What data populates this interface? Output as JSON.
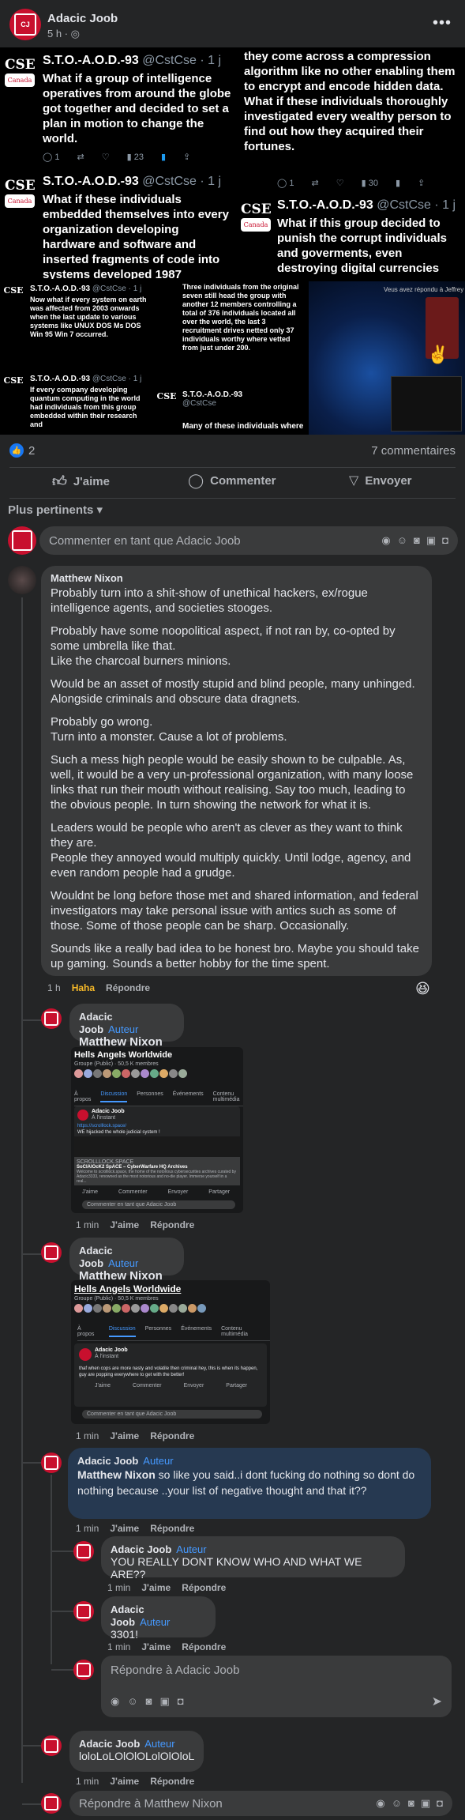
{
  "header": {
    "page_name": "Adacic Joob",
    "time": "5 h",
    "more_icon": "more-horizontal-icon"
  },
  "tweets": [
    {
      "handle": "S.T.O.-A.O.D.-93",
      "at": "@CstCse · 1 j",
      "body": "What if a group of intelligence operatives from around the globe got together and decided to set a plan in motion to change the world.",
      "stats": [
        "1",
        "",
        "",
        "23",
        "",
        ""
      ]
    },
    {
      "body": "they come across a compression algorithm like no other enabling them to encrypt and encode hidden data. What if these individuals thoroughly investigated every wealthy person to find out how they acquired their fortunes.",
      "stats": [
        "1",
        "",
        "",
        "30",
        "",
        ""
      ]
    },
    {
      "handle": "S.T.O.-A.O.D.-93",
      "at": "@CstCse · 1 j",
      "body": "What if these individuals embedded themselves into every organization developing hardware and software and inserted fragments of code into systems developed 1987"
    },
    {
      "handle": "S.T.O.-A.O.D.-93",
      "at": "@CstCse · 1 j",
      "body": "What if this group decided to punish the corrupt individuals and goverments, even destroying digital currencies"
    },
    {
      "handle": "S.T.O.-A.O.D.-93",
      "at": "@CstCse · 1 j",
      "body": "Now what if every system on earth was affected from 2003 onwards when the last update to various systems like UNUX DOS Ms DOS Win 95 Win 7 occurred."
    },
    {
      "body": "Three individuals from the original seven still head the group with another 12 members controlling a total of 376 individuals located all over the world, the last 3 recruitment drives netted only 37 individuals worthy where vetted from just under 200."
    },
    {
      "handle": "S.T.O.-A.O.D.-93",
      "at": "@CstCse · 1 j",
      "body": "If every company developing quantum computing in the world had individuals from this group embedded within their research and"
    },
    {
      "handle": "S.T.O.-A.O.D.-93",
      "at": "@CstCse",
      "body": "Many of these individuals where"
    }
  ],
  "cse_logo": {
    "text": "CSE",
    "sub": "Canada"
  },
  "image4": {
    "caption": "Veus avez répondu à Jeffrey"
  },
  "reactions": {
    "count": "2",
    "comments": "7 commentaires"
  },
  "actions": {
    "like": "J'aime",
    "comment": "Commenter",
    "share": "Envoyer"
  },
  "sort": {
    "label": "Plus pertinents"
  },
  "comment_box": {
    "placeholder": "Commenter en tant que Adacic Joob"
  },
  "comments": {
    "main": {
      "author": "Matthew Nixon",
      "paragraphs": [
        "Probably turn into a shit-show of unethical hackers, ex/rogue intelligence agents, and societies stooges.",
        "Probably have some noopolitical aspect, if not ran by, co-opted by some umbrella like that.\nLike the charcoal burners minions.",
        "Would be an asset of mostly stupid and blind people, many unhinged. Alongside criminals and obscure data dragnets.",
        "Probably go wrong.\nTurn into a monster. Cause a lot of problems.",
        "Such a mess high people would be easily shown to be culpable. As, well, it would be a very un-professional organization, with many loose links that run their mouth without realising. Say too much, leading to the obvious people. In turn showing the network for what it is.",
        "Leaders would be people who aren't as clever as they want to think they are.\nPeople they annoyed would multiply quickly. Until lodge, agency, and even random people had a grudge.",
        "Wouldnt be long before those met and shared information, and federal investigators may take personal issue with antics such as some of those. Some of those people can be sharp. Occasionally.",
        "Sounds like a really bad idea to be honest bro. Maybe you should take up gaming. Sounds a better hobby for the time spent."
      ],
      "time": "1 h",
      "reaction": "Haha",
      "reply": "Répondre",
      "emoji": "laughing-emoji"
    },
    "reply1": {
      "author": "Adacic Joob",
      "badge": "Auteur",
      "mention": "Matthew Nixon",
      "time": "1 min",
      "like": "J'aime",
      "reply": "Répondre",
      "shot": {
        "group": "Hells Angels Worldwide",
        "sub": "Groupe (Public) · 50,5 K membres",
        "tabs": [
          "À propos",
          "Discussion",
          "Personnes",
          "Événements",
          "Contenu multimédia"
        ],
        "poster": "Adacic Joob",
        "post_time": "À l'instant",
        "post_text": "https://scrolllock.space/",
        "post_text2": "WE hijacked the whole judicial system !",
        "link_domain": "SCROLLLOCK.SPACE",
        "link_title": "SoCIAlOcK2 SpACE – CyberWarfare HQ Archives",
        "link_desc": "Welcome to scrolllock.space, the home of the notorious cybersecurities archives curated by Adacic3333, renowned as the most notorious and no-die player. Immerse yourself in a real...",
        "act_like": "J'aime",
        "act_comment": "Commenter",
        "act_send": "Envoyer",
        "act_share": "Partager",
        "box": "Commenter en tant que Adacic Joob"
      }
    },
    "reply2": {
      "author": "Adacic Joob",
      "badge": "Auteur",
      "mention": "Matthew Nixon",
      "time": "1 min",
      "like": "J'aime",
      "reply": "Répondre",
      "shot": {
        "group": "Hells Angels Worldwide",
        "sub": "Groupe (Public) · 50,5 K membres",
        "tabs": [
          "À propos",
          "Discussion",
          "Personnes",
          "Événements",
          "Contenu multimédia"
        ],
        "poster": "Adacic Joob",
        "post_time": "À l'instant",
        "post_text": "thaf when cops are more nasty and volatile then criminal hey, this is when its happen, guy are popping everywhere to get with the better!",
        "act_like": "J'aime",
        "act_comment": "Commenter",
        "act_send": "Envoyer",
        "act_share": "Partager",
        "box": "Commenter en tant que Adacic Joob"
      }
    },
    "reply3": {
      "author": "Adacic Joob",
      "badge": "Auteur",
      "mention": "Matthew Nixon",
      "text": " so like you said..i dont fucking do nothing so dont do nothing because ..your list of negative thought and that it??",
      "time": "1 min",
      "like": "J'aime",
      "reply": "Répondre"
    },
    "reply4": {
      "author": "Adacic Joob",
      "badge": "Auteur",
      "text": "YOU REALLY DONT KNOW WHO AND WHAT WE ARE??",
      "time": "1 min",
      "like": "J'aime",
      "reply": "Répondre"
    },
    "reply5": {
      "author": "Adacic Joob",
      "badge": "Auteur",
      "text": "3301!",
      "time": "1 min",
      "like": "J'aime",
      "reply": "Répondre"
    },
    "reply_box": {
      "placeholder": "Répondre à Adacic Joob"
    },
    "reply6": {
      "author": "Adacic Joob",
      "badge": "Auteur",
      "text": "loloLoLOlOlOLolOlOloL",
      "time": "1 min",
      "like": "J'aime",
      "reply": "Répondre"
    },
    "bottom_box": {
      "placeholder": "Répondre à Matthew Nixon"
    }
  },
  "colors": {
    "bg": "#242526",
    "bubble": "#3a3b3c",
    "highlight": "#263951",
    "accent": "#4599ff",
    "haha": "#f7b928",
    "like_blue": "#1877f2"
  }
}
